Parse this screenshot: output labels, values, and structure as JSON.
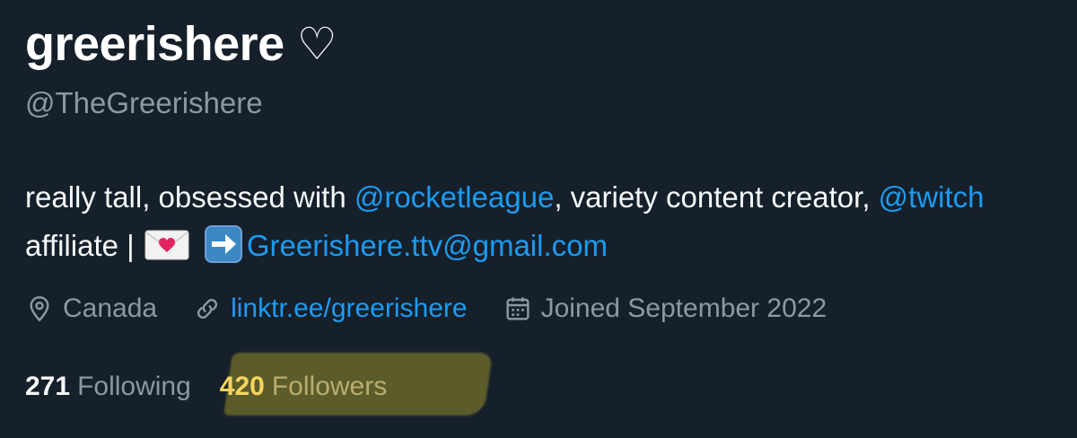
{
  "profile": {
    "display_name": "greerishere",
    "name_heart": "♡",
    "handle": "@TheGreerishere"
  },
  "bio": {
    "part1": "really tall, obsessed with ",
    "mention_rocketleague": "@rocketleague",
    "part2": ", variety content creator, ",
    "mention_twitch": "@twitch",
    "part3": " affiliate | ",
    "email": "Greerishere.ttv@gmail.com"
  },
  "meta": {
    "location": "Canada",
    "website": "linktr.ee/greerishere",
    "joined": "Joined September 2022"
  },
  "stats": {
    "following_count": "271",
    "following_label": "Following",
    "followers_count": "420",
    "followers_label": "Followers"
  },
  "icons": {
    "location": "location-pin-icon",
    "link": "link-icon",
    "calendar": "calendar-icon",
    "envelope": "love-letter-emoji",
    "arrow": "right-arrow-emoji"
  },
  "colors": {
    "background": "#15202b",
    "text": "#f7f9f9",
    "secondary": "#8b98a5",
    "link": "#1d9bf0",
    "highlight": "#beaf28"
  }
}
